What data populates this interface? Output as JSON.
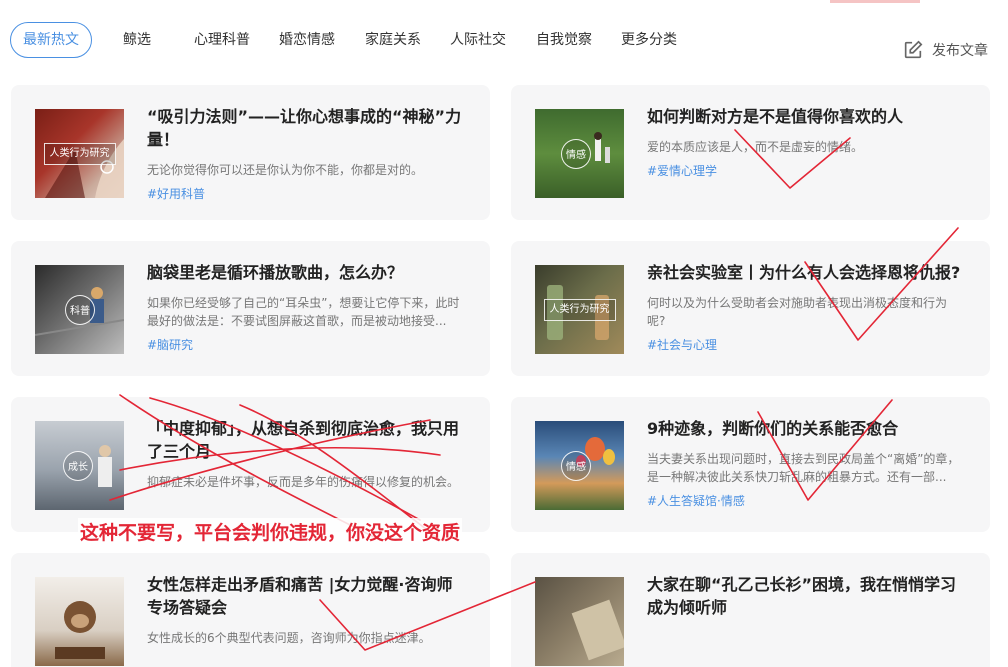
{
  "nav": {
    "tabs": [
      "最新热文",
      "鲸选",
      "心理科普",
      "婚恋情感",
      "家庭关系",
      "人际社交",
      "自我觉察",
      "更多分类"
    ],
    "publish_label": "发布文章"
  },
  "articles": [
    {
      "title": "“吸引力法则”——让你心想事成的“神秘”力量！",
      "desc": "无论你觉得你可以还是你认为你不能，你都是对的。",
      "tag": "#好用科普",
      "badge": "人类行为研究",
      "thumb_icon": "hand-ring-photo"
    },
    {
      "title": "如何判断对方是不是值得你喜欢的人",
      "desc": "爱的本质应该是人，而不是虚妄的情绪。",
      "tag": "#爱情心理学",
      "badge": "情感",
      "thumb_icon": "grass-field-photo"
    },
    {
      "title": "脑袋里老是循环播放歌曲，怎么办？",
      "desc": "如果你已经受够了自己的“耳朵虫”，想要让它停下来，此时最好的做法是：不要试图屏蔽这首歌，而是被动地接受...",
      "tag": "#脑研究",
      "badge": "科普",
      "thumb_icon": "sitting-person-photo"
    },
    {
      "title": "亲社会实验室丨为什么有人会选择恩将仇报?",
      "desc": "何时以及为什么受助者会对施助者表现出消极态度和行为呢?",
      "tag": "#社会与心理",
      "badge": "人类行为研究",
      "thumb_icon": "glass-bottle-photo"
    },
    {
      "title": "「中度抑郁」，从想自杀到彻底治愈，我只用了三个月",
      "desc": "抑郁症未必是件坏事，反而是多年的伤痛得以修复的机会。",
      "tag": "",
      "badge": "成长",
      "thumb_icon": "beach-person-photo"
    },
    {
      "title": "9种迹象，判断你们的关系能否愈合",
      "desc": "当夫妻关系出现问题时，直接去到民政局盖个“离婚”的章，是一种解决彼此关系快刀斩乱麻的粗暴方式。还有一部...",
      "tag": "#人生答疑馆·情感",
      "badge": "情感",
      "thumb_icon": "hot-air-balloon-photo"
    },
    {
      "title": "女性怎样走出矛盾和痛苦 |女力觉醒·咨询师专场答疑会",
      "desc": "女性成长的6个典型代表问题，咨询师为你指点迷津。",
      "tag": "",
      "badge": "",
      "thumb_icon": "monkey-photo"
    },
    {
      "title": "大家在聊“孔乙己长衫”困境，我在悄悄学习成为倾听师",
      "desc": "",
      "tag": "",
      "badge": "",
      "thumb_icon": "need-sign-photo"
    }
  ],
  "annotation": {
    "warning_text": "这种不要写，平台会判你违规，你没这个资质",
    "stray_text": "咨询",
    "color": "#e32636"
  },
  "colors": {
    "accent": "#4a90e2",
    "card_bg": "#f6f6f7",
    "annotation": "#e32636"
  }
}
